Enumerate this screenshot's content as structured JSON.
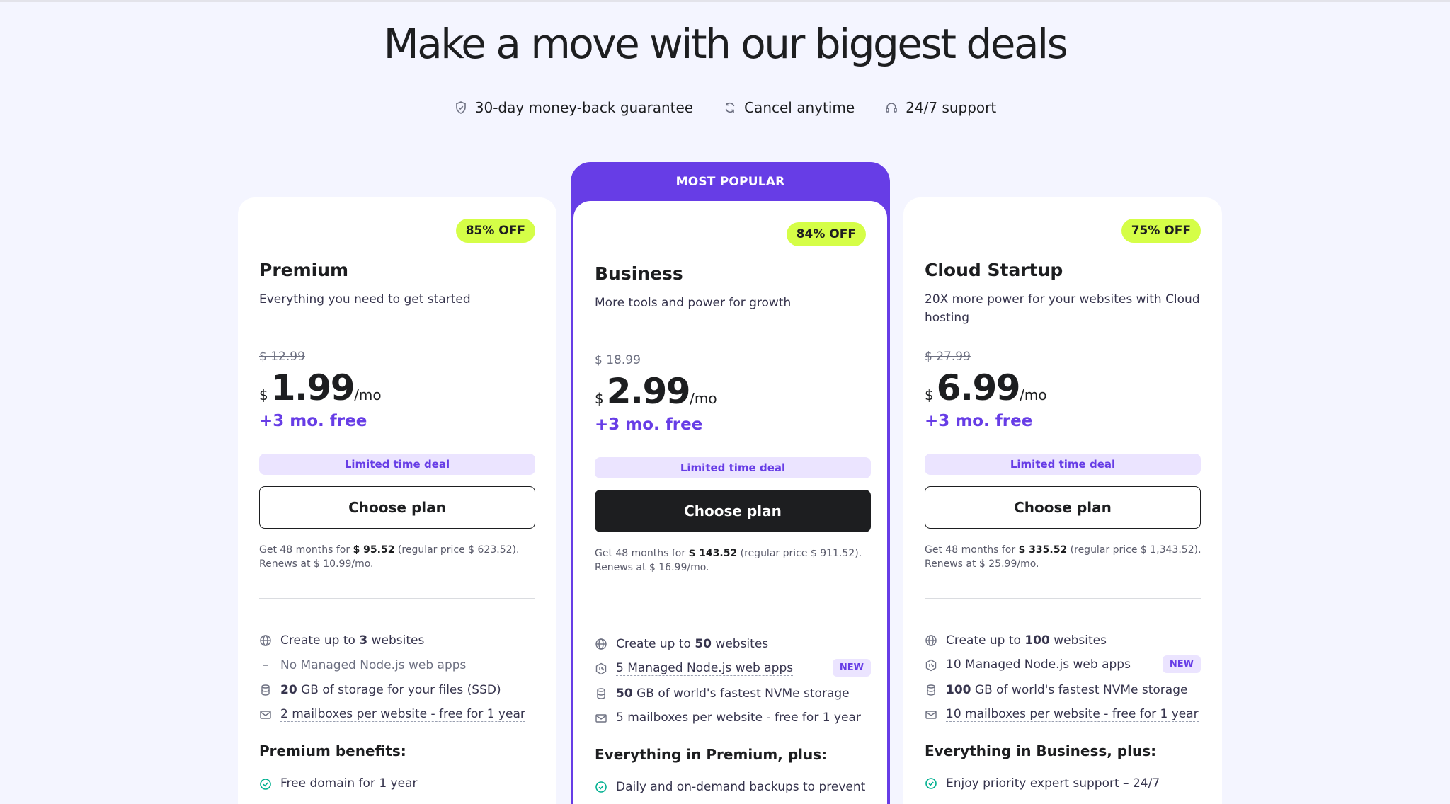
{
  "page": {
    "title": "Make a move with our biggest deals",
    "guarantees": [
      {
        "icon": "shield-icon",
        "label": "30-day money-back guarantee"
      },
      {
        "icon": "refresh-icon",
        "label": "Cancel anytime"
      },
      {
        "icon": "headset-icon",
        "label": "24/7 support"
      }
    ]
  },
  "colors": {
    "accent": "#673de6",
    "badge": "#d5fe47",
    "background": "#f4f5ff"
  },
  "plans": [
    {
      "name": "Premium",
      "description": "Everything you need to get started",
      "badge": "85% OFF",
      "old_price": "$ 12.99",
      "currency": "$",
      "price": "1.99",
      "per": "/mo",
      "free": "+3 mo. free",
      "deal": "Limited time deal",
      "cta": "Choose plan",
      "terms_pre": "Get 48 months for ",
      "terms_total": "$ 95.52",
      "terms_post": " (regular price $ 623.52). Renews at $ 10.99/mo.",
      "features": [
        {
          "pre": "Create up to ",
          "bold": "3",
          "post": " websites"
        },
        {
          "text": "No Managed Node.js web apps"
        },
        {
          "bold": "20",
          "post": " GB of storage for your files (SSD)"
        },
        {
          "text": "2 mailboxes per website - free for 1 year"
        }
      ],
      "benefits_title": "Premium benefits:",
      "benefit": "Free domain for 1 year"
    },
    {
      "popular_label": "MOST POPULAR",
      "name": "Business",
      "description": "More tools and power for growth",
      "badge": "84% OFF",
      "old_price": "$ 18.99",
      "currency": "$",
      "price": "2.99",
      "per": "/mo",
      "free": "+3 mo. free",
      "deal": "Limited time deal",
      "cta": "Choose plan",
      "terms_pre": "Get 48 months for ",
      "terms_total": "$ 143.52",
      "terms_post": " (regular price $ 911.52). Renews at $ 16.99/mo.",
      "features": [
        {
          "pre": "Create up to ",
          "bold": "50",
          "post": " websites"
        },
        {
          "text": "5 Managed Node.js web apps",
          "tag": "NEW"
        },
        {
          "bold": "50",
          "post": " GB of world's fastest NVMe storage"
        },
        {
          "text": "5 mailboxes per website - free for 1 year"
        }
      ],
      "benefits_title": "Everything in Premium, plus:",
      "benefit": "Daily and on-demand backups to prevent"
    },
    {
      "name": "Cloud Startup",
      "description": "20X more power for your websites with Cloud hosting",
      "badge": "75% OFF",
      "old_price": "$ 27.99",
      "currency": "$",
      "price": "6.99",
      "per": "/mo",
      "free": "+3 mo. free",
      "deal": "Limited time deal",
      "cta": "Choose plan",
      "terms_pre": "Get 48 months for ",
      "terms_total": "$ 335.52",
      "terms_post": " (regular price $ 1,343.52). Renews at $ 25.99/mo.",
      "features": [
        {
          "pre": "Create up to ",
          "bold": "100",
          "post": " websites"
        },
        {
          "text": "10 Managed Node.js web apps",
          "tag": "NEW"
        },
        {
          "bold": "100",
          "post": " GB of world's fastest NVMe storage"
        },
        {
          "text": "10 mailboxes per website - free for 1 year"
        }
      ],
      "benefits_title": "Everything in Business, plus:",
      "benefit": "Enjoy priority expert support – 24/7"
    }
  ]
}
